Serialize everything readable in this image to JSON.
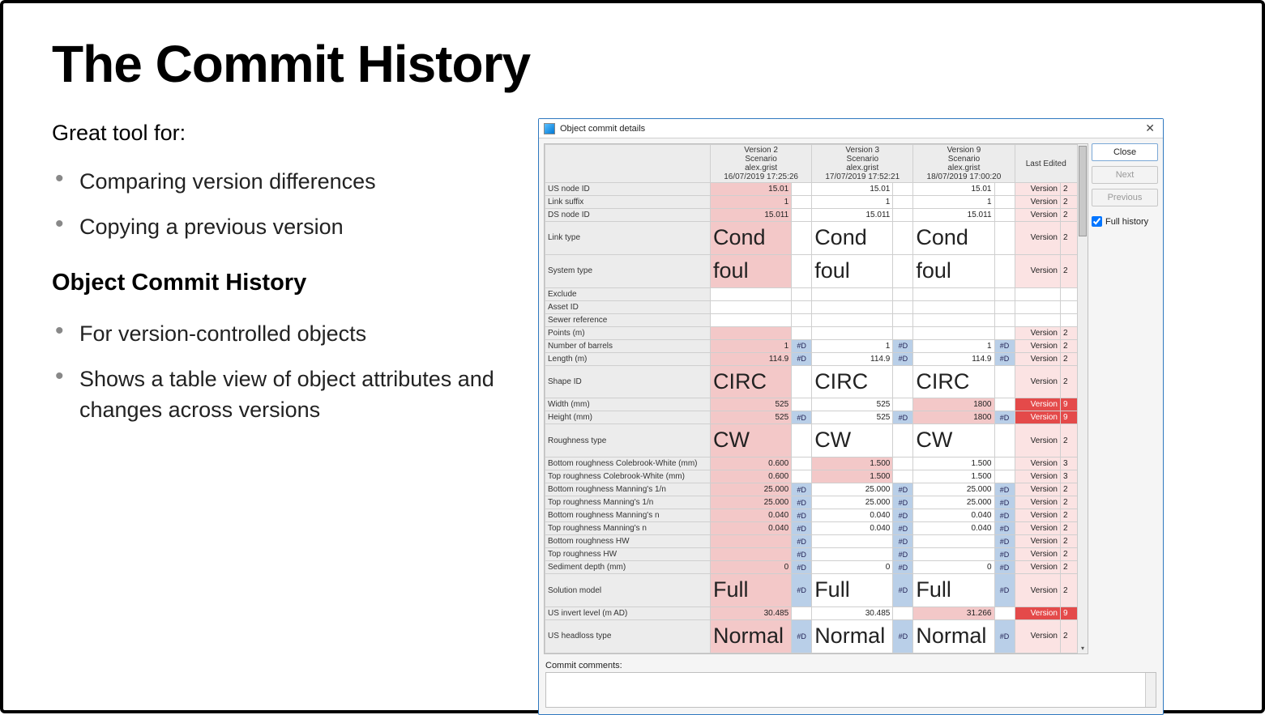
{
  "title": "The Commit History",
  "intro": "Great tool for:",
  "bulletsA": [
    "Comparing version differences",
    "Copying a previous version"
  ],
  "subhead": "Object Commit History",
  "bulletsB": [
    "For version-controlled objects",
    "Shows a table view of object attributes and changes across versions"
  ],
  "dialog": {
    "title": "Object commit details",
    "close_x": "✕",
    "buttons": {
      "close": "Close",
      "next": "Next",
      "prev": "Previous"
    },
    "full_history_label": "Full history",
    "full_history_checked": true,
    "comments_label": "Commit comments:",
    "columns": [
      {
        "version": "Version 2",
        "scenario": "Scenario",
        "user": "alex.grist",
        "date": "16/07/2019 17:25:26"
      },
      {
        "version": "Version 3",
        "scenario": "Scenario",
        "user": "alex.grist",
        "date": "17/07/2019 17:52:21"
      },
      {
        "version": "Version 9",
        "scenario": "Scenario",
        "user": "alex.grist",
        "date": "18/07/2019 17:00:20"
      }
    ],
    "last_edited_header": "Last Edited",
    "rows": [
      {
        "name": "US node ID",
        "v": [
          {
            "t": "15.01",
            "c": "pink",
            "f": ""
          },
          {
            "t": "15.01",
            "c": "",
            "f": ""
          },
          {
            "t": "15.01",
            "c": "",
            "f": ""
          }
        ],
        "lv": "Version",
        "ln": "2",
        "lc": "pinklite"
      },
      {
        "name": "Link suffix",
        "v": [
          {
            "t": "1",
            "c": "pink",
            "f": ""
          },
          {
            "t": "1",
            "c": "",
            "f": ""
          },
          {
            "t": "1",
            "c": "",
            "f": ""
          }
        ],
        "lv": "Version",
        "ln": "2",
        "lc": "pinklite"
      },
      {
        "name": "DS node ID",
        "v": [
          {
            "t": "15.011",
            "c": "pink",
            "f": ""
          },
          {
            "t": "15.011",
            "c": "",
            "f": ""
          },
          {
            "t": "15.011",
            "c": "",
            "f": ""
          }
        ],
        "lv": "Version",
        "ln": "2",
        "lc": "pinklite"
      },
      {
        "name": "Link type",
        "v": [
          {
            "t": "Cond",
            "c": "pink",
            "f": "",
            "a": "left"
          },
          {
            "t": "Cond",
            "c": "",
            "f": "",
            "a": "left"
          },
          {
            "t": "Cond",
            "c": "",
            "f": "",
            "a": "left"
          }
        ],
        "lv": "Version",
        "ln": "2",
        "lc": "pinklite"
      },
      {
        "name": "System type",
        "v": [
          {
            "t": "foul",
            "c": "pink",
            "f": "",
            "a": "left"
          },
          {
            "t": "foul",
            "c": "",
            "f": "",
            "a": "left"
          },
          {
            "t": "foul",
            "c": "",
            "f": "",
            "a": "left"
          }
        ],
        "lv": "Version",
        "ln": "2",
        "lc": "pinklite"
      },
      {
        "name": "Exclude",
        "v": [
          {
            "t": "",
            "c": "",
            "f": ""
          },
          {
            "t": "",
            "c": "",
            "f": ""
          },
          {
            "t": "",
            "c": "",
            "f": ""
          }
        ],
        "lv": "",
        "ln": "",
        "lc": ""
      },
      {
        "name": "Asset ID",
        "v": [
          {
            "t": "",
            "c": "",
            "f": ""
          },
          {
            "t": "",
            "c": "",
            "f": ""
          },
          {
            "t": "",
            "c": "",
            "f": ""
          }
        ],
        "lv": "",
        "ln": "",
        "lc": ""
      },
      {
        "name": "Sewer reference",
        "v": [
          {
            "t": "",
            "c": "",
            "f": ""
          },
          {
            "t": "",
            "c": "",
            "f": ""
          },
          {
            "t": "",
            "c": "",
            "f": ""
          }
        ],
        "lv": "",
        "ln": "",
        "lc": ""
      },
      {
        "name": "Points (m)",
        "v": [
          {
            "t": "",
            "c": "pink",
            "f": ""
          },
          {
            "t": "",
            "c": "",
            "f": ""
          },
          {
            "t": "",
            "c": "",
            "f": ""
          }
        ],
        "lv": "Version",
        "ln": "2",
        "lc": "pinklite"
      },
      {
        "name": "Number of barrels",
        "v": [
          {
            "t": "1",
            "c": "pink",
            "f": "#D"
          },
          {
            "t": "1",
            "c": "",
            "f": "#D"
          },
          {
            "t": "1",
            "c": "",
            "f": "#D"
          }
        ],
        "lv": "Version",
        "ln": "2",
        "lc": "pinklite"
      },
      {
        "name": "Length (m)",
        "v": [
          {
            "t": "114.9",
            "c": "pink",
            "f": "#D"
          },
          {
            "t": "114.9",
            "c": "",
            "f": "#D"
          },
          {
            "t": "114.9",
            "c": "",
            "f": "#D"
          }
        ],
        "lv": "Version",
        "ln": "2",
        "lc": "pinklite"
      },
      {
        "name": "Shape ID",
        "v": [
          {
            "t": "CIRC",
            "c": "pink",
            "f": "",
            "a": "left"
          },
          {
            "t": "CIRC",
            "c": "",
            "f": "",
            "a": "left"
          },
          {
            "t": "CIRC",
            "c": "",
            "f": "",
            "a": "left"
          }
        ],
        "lv": "Version",
        "ln": "2",
        "lc": "pinklite"
      },
      {
        "name": "Width (mm)",
        "v": [
          {
            "t": "525",
            "c": "pink",
            "f": ""
          },
          {
            "t": "525",
            "c": "",
            "f": ""
          },
          {
            "t": "1800",
            "c": "pink",
            "f": ""
          }
        ],
        "lv": "Version",
        "ln": "9",
        "lc": "red"
      },
      {
        "name": "Height (mm)",
        "v": [
          {
            "t": "525",
            "c": "pink",
            "f": "#D"
          },
          {
            "t": "525",
            "c": "",
            "f": "#D"
          },
          {
            "t": "1800",
            "c": "pink",
            "f": "#D"
          }
        ],
        "lv": "Version",
        "ln": "9",
        "lc": "red"
      },
      {
        "name": "Roughness type",
        "v": [
          {
            "t": "CW",
            "c": "pink",
            "f": "",
            "a": "left"
          },
          {
            "t": "CW",
            "c": "",
            "f": "",
            "a": "left"
          },
          {
            "t": "CW",
            "c": "",
            "f": "",
            "a": "left"
          }
        ],
        "lv": "Version",
        "ln": "2",
        "lc": "pinklite"
      },
      {
        "name": "Bottom roughness Colebrook-White (mm)",
        "v": [
          {
            "t": "0.600",
            "c": "pink",
            "f": ""
          },
          {
            "t": "1.500",
            "c": "pink",
            "f": ""
          },
          {
            "t": "1.500",
            "c": "",
            "f": ""
          }
        ],
        "lv": "Version",
        "ln": "3",
        "lc": "pinklite"
      },
      {
        "name": "Top roughness Colebrook-White (mm)",
        "v": [
          {
            "t": "0.600",
            "c": "pink",
            "f": ""
          },
          {
            "t": "1.500",
            "c": "pink",
            "f": ""
          },
          {
            "t": "1.500",
            "c": "",
            "f": ""
          }
        ],
        "lv": "Version",
        "ln": "3",
        "lc": "pinklite"
      },
      {
        "name": "Bottom roughness Manning's 1/n",
        "v": [
          {
            "t": "25.000",
            "c": "pink",
            "f": "#D"
          },
          {
            "t": "25.000",
            "c": "",
            "f": "#D"
          },
          {
            "t": "25.000",
            "c": "",
            "f": "#D"
          }
        ],
        "lv": "Version",
        "ln": "2",
        "lc": "pinklite"
      },
      {
        "name": "Top roughness Manning's 1/n",
        "v": [
          {
            "t": "25.000",
            "c": "pink",
            "f": "#D"
          },
          {
            "t": "25.000",
            "c": "",
            "f": "#D"
          },
          {
            "t": "25.000",
            "c": "",
            "f": "#D"
          }
        ],
        "lv": "Version",
        "ln": "2",
        "lc": "pinklite"
      },
      {
        "name": "Bottom roughness Manning's n",
        "v": [
          {
            "t": "0.040",
            "c": "pink",
            "f": "#D"
          },
          {
            "t": "0.040",
            "c": "",
            "f": "#D"
          },
          {
            "t": "0.040",
            "c": "",
            "f": "#D"
          }
        ],
        "lv": "Version",
        "ln": "2",
        "lc": "pinklite"
      },
      {
        "name": "Top roughness Manning's n",
        "v": [
          {
            "t": "0.040",
            "c": "pink",
            "f": "#D"
          },
          {
            "t": "0.040",
            "c": "",
            "f": "#D"
          },
          {
            "t": "0.040",
            "c": "",
            "f": "#D"
          }
        ],
        "lv": "Version",
        "ln": "2",
        "lc": "pinklite"
      },
      {
        "name": "Bottom roughness HW",
        "v": [
          {
            "t": "",
            "c": "pink",
            "f": "#D"
          },
          {
            "t": "",
            "c": "",
            "f": "#D"
          },
          {
            "t": "",
            "c": "",
            "f": "#D"
          }
        ],
        "lv": "Version",
        "ln": "2",
        "lc": "pinklite"
      },
      {
        "name": "Top roughness HW",
        "v": [
          {
            "t": "",
            "c": "pink",
            "f": "#D"
          },
          {
            "t": "",
            "c": "",
            "f": "#D"
          },
          {
            "t": "",
            "c": "",
            "f": "#D"
          }
        ],
        "lv": "Version",
        "ln": "2",
        "lc": "pinklite"
      },
      {
        "name": "Sediment depth (mm)",
        "v": [
          {
            "t": "0",
            "c": "pink",
            "f": "#D"
          },
          {
            "t": "0",
            "c": "",
            "f": "#D"
          },
          {
            "t": "0",
            "c": "",
            "f": "#D"
          }
        ],
        "lv": "Version",
        "ln": "2",
        "lc": "pinklite"
      },
      {
        "name": "Solution model",
        "v": [
          {
            "t": "Full",
            "c": "pink",
            "f": "#D",
            "a": "left"
          },
          {
            "t": "Full",
            "c": "",
            "f": "#D",
            "a": "left"
          },
          {
            "t": "Full",
            "c": "",
            "f": "#D",
            "a": "left"
          }
        ],
        "lv": "Version",
        "ln": "2",
        "lc": "pinklite"
      },
      {
        "name": "US invert level (m AD)",
        "v": [
          {
            "t": "30.485",
            "c": "pink",
            "f": ""
          },
          {
            "t": "30.485",
            "c": "",
            "f": ""
          },
          {
            "t": "31.266",
            "c": "pink",
            "f": ""
          }
        ],
        "lv": "Version",
        "ln": "9",
        "lc": "red"
      },
      {
        "name": "US headloss type",
        "v": [
          {
            "t": "Normal",
            "c": "pink",
            "f": "#D",
            "a": "left"
          },
          {
            "t": "Normal",
            "c": "",
            "f": "#D",
            "a": "left"
          },
          {
            "t": "Normal",
            "c": "",
            "f": "#D",
            "a": "left"
          }
        ],
        "lv": "Version",
        "ln": "2",
        "lc": "pinklite"
      }
    ]
  }
}
